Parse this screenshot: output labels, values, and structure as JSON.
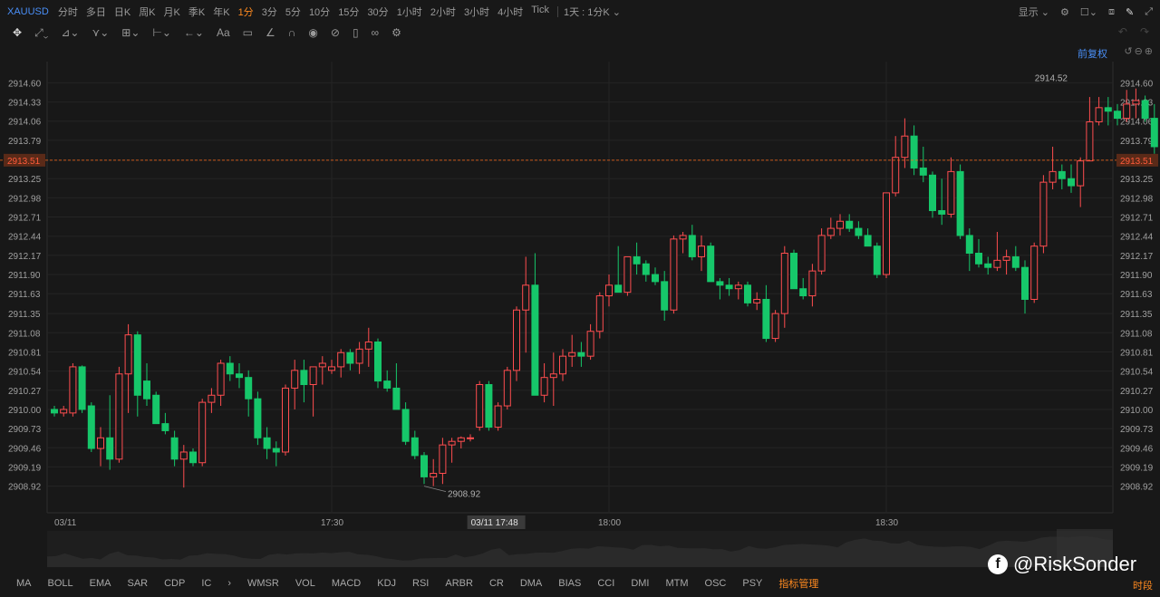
{
  "toolbar": {
    "symbol": "XAUUSD",
    "timeframes": [
      "分时",
      "多日",
      "日K",
      "周K",
      "月K",
      "季K",
      "年K",
      "1分",
      "3分",
      "5分",
      "10分",
      "15分",
      "30分",
      "1小时",
      "2小时",
      "3小时",
      "4小时",
      "Tick"
    ],
    "active_timeframe": "1分",
    "period_select": "1天 : 1分K",
    "display_label": "显示",
    "restore_label": "前复权"
  },
  "bottom": {
    "indicators": [
      "MA",
      "BOLL",
      "EMA",
      "SAR",
      "CDP",
      "IC",
      "WMSR",
      "VOL",
      "MACD",
      "KDJ",
      "RSI",
      "ARBR",
      "CR",
      "DMA",
      "BIAS",
      "CCI",
      "DMI",
      "MTM",
      "OSC",
      "PSY"
    ],
    "manager_label": "指标管理",
    "period_label": "时段"
  },
  "watermark": "@RiskSonder",
  "colors": {
    "up": "#ff4d4f",
    "down": "#16c76a",
    "current_price": "#ff6b1a",
    "active": "#ff8a1f",
    "accent": "#4a8ff7"
  },
  "chart_data": {
    "type": "candlestick",
    "y_ticks": [
      2914.6,
      2914.33,
      2914.06,
      2913.79,
      2913.51,
      2913.25,
      2912.98,
      2912.71,
      2912.44,
      2912.17,
      2911.9,
      2911.63,
      2911.35,
      2911.08,
      2910.81,
      2910.54,
      2910.27,
      2910.0,
      2909.73,
      2909.46,
      2909.19,
      2908.92
    ],
    "ylim": [
      2908.8,
      2914.72
    ],
    "x_labels": [
      {
        "text": "03/11",
        "index": 0
      },
      {
        "text": "17:30",
        "index": 30
      },
      {
        "text": "18:00",
        "index": 60
      },
      {
        "text": "18:30",
        "index": 90
      }
    ],
    "crosshair_label": {
      "text": "03/11 17:48",
      "index": 48
    },
    "current_price": 2913.51,
    "max_label": {
      "text": "2914.52",
      "index": 109,
      "value": 2914.52
    },
    "min_label": {
      "text": "2908.92",
      "index": 40,
      "value": 2908.92
    },
    "candles": [
      [
        2910.0,
        2910.05,
        2909.9,
        2909.95
      ],
      [
        2909.95,
        2910.05,
        2909.9,
        2910.0
      ],
      [
        2909.95,
        2910.65,
        2909.9,
        2910.6
      ],
      [
        2910.6,
        2910.62,
        2909.95,
        2910.0
      ],
      [
        2910.05,
        2910.1,
        2909.4,
        2909.45
      ],
      [
        2909.45,
        2909.75,
        2909.2,
        2909.6
      ],
      [
        2909.6,
        2910.2,
        2909.15,
        2909.3
      ],
      [
        2909.3,
        2910.6,
        2909.25,
        2910.5
      ],
      [
        2910.5,
        2911.2,
        2909.95,
        2911.05
      ],
      [
        2911.05,
        2911.1,
        2909.9,
        2910.2
      ],
      [
        2910.4,
        2910.65,
        2910.05,
        2910.15
      ],
      [
        2910.2,
        2910.25,
        2909.8,
        2909.8
      ],
      [
        2909.8,
        2909.95,
        2909.65,
        2909.7
      ],
      [
        2909.6,
        2909.7,
        2909.2,
        2909.3
      ],
      [
        2909.3,
        2909.5,
        2908.9,
        2909.4
      ],
      [
        2909.4,
        2909.45,
        2909.2,
        2909.25
      ],
      [
        2909.25,
        2910.15,
        2909.2,
        2910.1
      ],
      [
        2910.1,
        2910.3,
        2909.95,
        2910.2
      ],
      [
        2910.2,
        2910.7,
        2910.05,
        2910.65
      ],
      [
        2910.65,
        2910.75,
        2910.4,
        2910.5
      ],
      [
        2910.5,
        2910.65,
        2910.3,
        2910.45
      ],
      [
        2910.45,
        2910.55,
        2909.9,
        2910.15
      ],
      [
        2910.15,
        2910.25,
        2909.5,
        2909.6
      ],
      [
        2909.6,
        2909.75,
        2909.3,
        2909.45
      ],
      [
        2909.45,
        2909.55,
        2909.2,
        2909.4
      ],
      [
        2909.4,
        2910.35,
        2909.35,
        2910.3
      ],
      [
        2910.3,
        2910.7,
        2910.0,
        2910.55
      ],
      [
        2910.55,
        2910.7,
        2910.1,
        2910.35
      ],
      [
        2910.35,
        2910.55,
        2909.9,
        2910.6
      ],
      [
        2910.6,
        2910.75,
        2910.35,
        2910.65
      ],
      [
        2910.55,
        2910.7,
        2910.5,
        2910.6
      ],
      [
        2910.6,
        2910.85,
        2910.45,
        2910.8
      ],
      [
        2910.8,
        2910.85,
        2910.55,
        2910.65
      ],
      [
        2910.65,
        2910.95,
        2910.5,
        2910.85
      ],
      [
        2910.85,
        2911.15,
        2910.6,
        2910.95
      ],
      [
        2910.95,
        2911.0,
        2910.3,
        2910.4
      ],
      [
        2910.4,
        2910.55,
        2910.25,
        2910.3
      ],
      [
        2910.3,
        2910.65,
        2910.0,
        2910.0
      ],
      [
        2910.0,
        2910.1,
        2909.5,
        2909.55
      ],
      [
        2909.6,
        2909.7,
        2909.3,
        2909.35
      ],
      [
        2909.35,
        2909.4,
        2908.95,
        2909.05
      ],
      [
        2909.05,
        2909.3,
        2908.92,
        2909.1
      ],
      [
        2909.1,
        2909.6,
        2908.95,
        2909.5
      ],
      [
        2909.5,
        2909.6,
        2909.25,
        2909.55
      ],
      [
        2909.55,
        2909.62,
        2909.45,
        2909.6
      ],
      [
        2909.6,
        2909.65,
        2909.55,
        2909.6
      ],
      [
        2909.75,
        2910.4,
        2909.7,
        2910.35
      ],
      [
        2910.35,
        2910.4,
        2909.7,
        2909.75
      ],
      [
        2909.75,
        2910.1,
        2909.7,
        2910.05
      ],
      [
        2910.05,
        2910.6,
        2910.0,
        2910.55
      ],
      [
        2910.55,
        2911.45,
        2910.4,
        2911.4
      ],
      [
        2911.4,
        2912.15,
        2910.8,
        2911.75
      ],
      [
        2911.75,
        2912.2,
        2910.2,
        2910.2
      ],
      [
        2910.2,
        2910.65,
        2910.1,
        2910.45
      ],
      [
        2910.45,
        2910.8,
        2910.05,
        2910.5
      ],
      [
        2910.5,
        2910.85,
        2910.4,
        2910.75
      ],
      [
        2910.75,
        2911.05,
        2910.6,
        2910.8
      ],
      [
        2910.8,
        2910.95,
        2910.6,
        2910.75
      ],
      [
        2910.75,
        2911.2,
        2910.7,
        2911.1
      ],
      [
        2911.1,
        2911.65,
        2911.0,
        2911.6
      ],
      [
        2911.6,
        2911.9,
        2911.45,
        2911.75
      ],
      [
        2911.75,
        2912.3,
        2911.65,
        2911.65
      ],
      [
        2911.65,
        2912.15,
        2911.6,
        2912.15
      ],
      [
        2912.15,
        2912.35,
        2911.9,
        2912.05
      ],
      [
        2912.05,
        2912.1,
        2911.8,
        2911.9
      ],
      [
        2911.9,
        2912.0,
        2911.75,
        2911.8
      ],
      [
        2911.8,
        2911.95,
        2911.25,
        2911.4
      ],
      [
        2911.4,
        2912.45,
        2911.35,
        2912.4
      ],
      [
        2912.4,
        2912.5,
        2912.2,
        2912.45
      ],
      [
        2912.45,
        2912.6,
        2912.1,
        2912.15
      ],
      [
        2912.15,
        2912.45,
        2911.95,
        2912.3
      ],
      [
        2912.3,
        2912.35,
        2911.8,
        2911.8
      ],
      [
        2911.8,
        2911.85,
        2911.55,
        2911.75
      ],
      [
        2911.75,
        2911.85,
        2911.6,
        2911.7
      ],
      [
        2911.7,
        2911.8,
        2911.55,
        2911.75
      ],
      [
        2911.75,
        2911.8,
        2911.45,
        2911.5
      ],
      [
        2911.5,
        2911.65,
        2911.4,
        2911.55
      ],
      [
        2911.55,
        2911.75,
        2910.95,
        2911.0
      ],
      [
        2911.0,
        2911.4,
        2910.95,
        2911.35
      ],
      [
        2911.35,
        2912.3,
        2911.15,
        2912.2
      ],
      [
        2912.2,
        2912.25,
        2911.7,
        2911.7
      ],
      [
        2911.7,
        2911.85,
        2911.55,
        2911.6
      ],
      [
        2911.6,
        2912.05,
        2911.45,
        2911.95
      ],
      [
        2911.95,
        2912.55,
        2911.9,
        2912.45
      ],
      [
        2912.45,
        2912.7,
        2912.4,
        2912.55
      ],
      [
        2912.55,
        2912.75,
        2912.45,
        2912.65
      ],
      [
        2912.65,
        2912.75,
        2912.5,
        2912.55
      ],
      [
        2912.55,
        2912.65,
        2912.4,
        2912.45
      ],
      [
        2912.45,
        2912.55,
        2912.3,
        2912.3
      ],
      [
        2912.3,
        2912.35,
        2911.85,
        2911.9
      ],
      [
        2911.9,
        2913.05,
        2911.85,
        2913.05
      ],
      [
        2913.05,
        2913.85,
        2913.0,
        2913.55
      ],
      [
        2913.55,
        2914.1,
        2913.4,
        2913.85
      ],
      [
        2913.85,
        2914.0,
        2913.3,
        2913.4
      ],
      [
        2913.4,
        2913.7,
        2913.2,
        2913.3
      ],
      [
        2913.3,
        2913.35,
        2912.7,
        2912.8
      ],
      [
        2912.8,
        2913.25,
        2912.6,
        2912.75
      ],
      [
        2912.75,
        2913.55,
        2912.7,
        2913.35
      ],
      [
        2913.35,
        2913.45,
        2912.4,
        2912.45
      ],
      [
        2912.45,
        2912.55,
        2911.95,
        2912.2
      ],
      [
        2912.2,
        2912.4,
        2912.0,
        2912.05
      ],
      [
        2912.05,
        2912.15,
        2911.9,
        2912.0
      ],
      [
        2912.0,
        2912.5,
        2911.95,
        2912.1
      ],
      [
        2912.1,
        2912.25,
        2911.9,
        2912.15
      ],
      [
        2912.15,
        2912.3,
        2911.95,
        2912.0
      ],
      [
        2912.0,
        2912.1,
        2911.35,
        2911.55
      ],
      [
        2911.55,
        2912.35,
        2911.5,
        2912.3
      ],
      [
        2912.3,
        2913.3,
        2912.2,
        2913.2
      ],
      [
        2913.2,
        2913.7,
        2913.1,
        2913.35
      ],
      [
        2913.35,
        2913.45,
        2913.1,
        2913.25
      ],
      [
        2913.25,
        2913.45,
        2913.05,
        2913.15
      ],
      [
        2913.15,
        2913.55,
        2912.85,
        2913.5
      ],
      [
        2913.5,
        2914.4,
        2913.5,
        2914.05
      ],
      [
        2914.05,
        2914.4,
        2914.0,
        2914.25
      ],
      [
        2914.25,
        2914.4,
        2914.0,
        2914.2
      ],
      [
        2914.2,
        2914.3,
        2914.0,
        2914.1
      ],
      [
        2914.1,
        2914.5,
        2914.05,
        2914.3
      ],
      [
        2914.3,
        2914.52,
        2914.1,
        2914.35
      ],
      [
        2914.35,
        2914.42,
        2914.05,
        2914.1
      ],
      [
        2914.1,
        2914.3,
        2913.6,
        2913.7
      ],
      [
        2913.7,
        2913.75,
        2913.15,
        2913.51
      ]
    ]
  }
}
